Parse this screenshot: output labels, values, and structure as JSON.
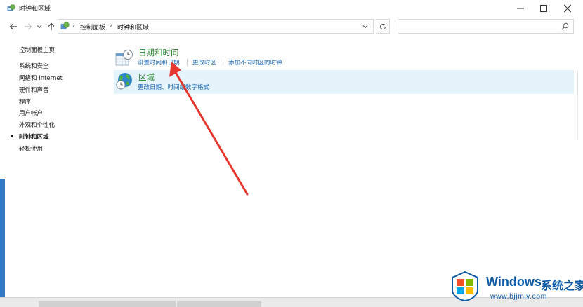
{
  "window": {
    "title": "时钟和区域",
    "controls": {
      "minimize_icon": "minimize-icon",
      "maximize_icon": "maximize-icon",
      "close_icon": "close-icon"
    }
  },
  "address_bar": {
    "breadcrumbs": [
      "控制面板",
      "时钟和区域"
    ],
    "search_placeholder": ""
  },
  "sidebar": {
    "items": [
      {
        "label": "控制面板主页",
        "active": false
      },
      {
        "label": "系统和安全",
        "active": false
      },
      {
        "label": "网络和 Internet",
        "active": false
      },
      {
        "label": "硬件和声音",
        "active": false
      },
      {
        "label": "程序",
        "active": false
      },
      {
        "label": "用户帐户",
        "active": false
      },
      {
        "label": "外观和个性化",
        "active": false
      },
      {
        "label": "时钟和区域",
        "active": true
      },
      {
        "label": "轻松使用",
        "active": false
      }
    ]
  },
  "categories": [
    {
      "title": "日期和时间",
      "icon": "calendar-clock-icon",
      "links": [
        "设置时间和日期",
        "更改时区",
        "添加不同时区的时钟"
      ]
    },
    {
      "title": "区域",
      "icon": "globe-clock-icon",
      "links": [
        "更改日期、时间或数字格式"
      ]
    }
  ],
  "annotation": {
    "type": "red-arrow",
    "color": "#e8362f"
  },
  "watermark": {
    "brand": "Windows",
    "cn_text": "系统之家",
    "url": "www.bjjmlv.com"
  },
  "colors": {
    "category_title": "#1e7d22",
    "link": "#1a66b3",
    "selected_row": "#e5f3fb",
    "watermark": "#0d5aa7"
  }
}
